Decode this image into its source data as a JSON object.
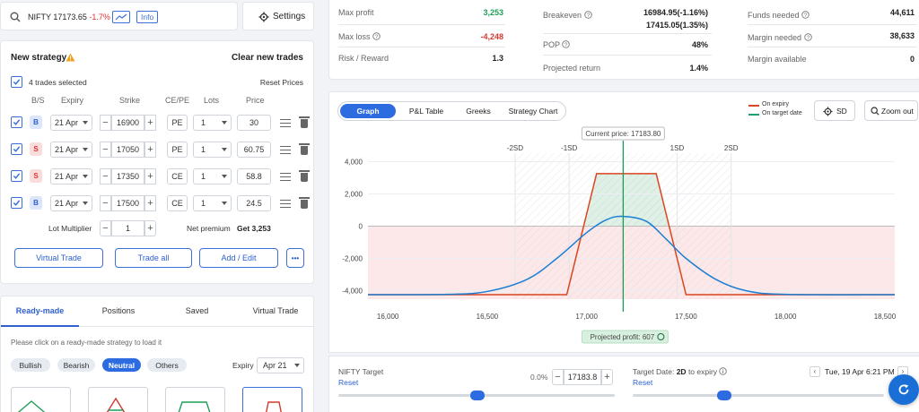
{
  "search": {
    "symbol": "NIFTY",
    "price": "17173.65",
    "change": "-1.7%",
    "info": "Info"
  },
  "settings_label": "Settings",
  "strategy": {
    "title": "New strategy",
    "clear": "Clear new trades",
    "selected": "4 trades selected",
    "reset_prices": "Reset Prices",
    "headers": {
      "bs": "B/S",
      "expiry": "Expiry",
      "strike": "Strike",
      "cepe": "CE/PE",
      "lots": "Lots",
      "price": "Price"
    },
    "trades": [
      {
        "bs": "B",
        "expiry": "21 Apr",
        "strike": "16900",
        "type": "PE",
        "lots": "1",
        "price": "30"
      },
      {
        "bs": "S",
        "expiry": "21 Apr",
        "strike": "17050",
        "type": "PE",
        "lots": "1",
        "price": "60.75"
      },
      {
        "bs": "S",
        "expiry": "21 Apr",
        "strike": "17350",
        "type": "CE",
        "lots": "1",
        "price": "58.8"
      },
      {
        "bs": "B",
        "expiry": "21 Apr",
        "strike": "17500",
        "type": "CE",
        "lots": "1",
        "price": "24.5"
      }
    ],
    "lot_multiplier_label": "Lot Multiplier",
    "lot_multiplier": "1",
    "net_premium_label": "Net premium",
    "net_premium": "Get 3,253",
    "buttons": {
      "virtual": "Virtual Trade",
      "trade_all": "Trade all",
      "add_edit": "Add / Edit",
      "more": "•••"
    }
  },
  "bottom_tabs": [
    "Ready-made",
    "Positions",
    "Saved",
    "Virtual Trade"
  ],
  "readymade": {
    "hint": "Please click on a ready-made strategy to load it",
    "filters": [
      "Bullish",
      "Bearish",
      "Neutral",
      "Others"
    ],
    "expiry_label": "Expiry",
    "expiry": "Apr 21"
  },
  "stats": {
    "max_profit_label": "Max profit",
    "max_profit": "3,253",
    "max_loss_label": "Max loss",
    "max_loss": "-4,248",
    "rr_label": "Risk / Reward",
    "rr": "1.3",
    "breakeven_label": "Breakeven",
    "breakeven1": "16984.95(-1.16%)",
    "breakeven2": "17415.05(1.35%)",
    "pop_label": "POP",
    "pop": "48%",
    "proj_return_label": "Projected return",
    "proj_return": "1.4%",
    "funds_label": "Funds needed",
    "funds": "44,611",
    "margin_label": "Margin needed",
    "margin": "38,633",
    "margin_avail_label": "Margin available",
    "margin_avail": "0"
  },
  "chart_tabs": [
    "Graph",
    "P&L Table",
    "Greeks",
    "Strategy Chart"
  ],
  "legend": {
    "expiry": "On expiry",
    "target": "On target date"
  },
  "sd_label": "SD",
  "zoom_label": "Zoom out",
  "current_price_label": "Current price: 17183.80",
  "projected_profit_label": "Projected profit: 607",
  "colors": {
    "expiry": "#d9461f",
    "target": "#1a7fd4",
    "accent": "#2d6be0",
    "profit": "#1e9e55",
    "loss": "#d33a2f"
  },
  "chart_data": {
    "type": "line",
    "x_ticks": [
      "16,000",
      "16,500",
      "17,000",
      "17,500",
      "18,000",
      "18,500"
    ],
    "y_ticks": [
      "4,000",
      "2,000",
      "0",
      "-2,000",
      "-4,000"
    ],
    "xlim": [
      15900,
      18550
    ],
    "ylim": [
      -4248,
      4248
    ],
    "sd_labels": [
      {
        "label": "-2SD",
        "x": 16640
      },
      {
        "label": "-1SD",
        "x": 16912
      },
      {
        "label": "1SD",
        "x": 17455
      },
      {
        "label": "2SD",
        "x": 17727
      }
    ],
    "current_price": 17183.8,
    "series": [
      {
        "name": "On expiry",
        "x": [
          15900,
          16900,
          17050,
          17350,
          17500,
          18550
        ],
        "y": [
          -4248,
          -4248,
          3253,
          3253,
          -4248,
          -4248
        ]
      },
      {
        "name": "On target date",
        "x": [
          15900,
          16300,
          16500,
          16700,
          16850,
          17000,
          17100,
          17183.8,
          17300,
          17400,
          17500,
          17650,
          17800,
          18000,
          18550
        ],
        "y": [
          -4248,
          -4230,
          -4050,
          -3300,
          -2000,
          -400,
          400,
          607,
          300,
          -800,
          -2000,
          -3300,
          -4000,
          -4230,
          -4248
        ]
      }
    ]
  },
  "footer": {
    "target_label": "NIFTY Target",
    "reset": "Reset",
    "pct": "0.0%",
    "target_value": "17183.8",
    "target_date_label": "Target Date:",
    "days": "2D",
    "to_expiry": "to expiry",
    "reset2": "Reset",
    "date": "Tue, 19 Apr 6:21 PM"
  }
}
